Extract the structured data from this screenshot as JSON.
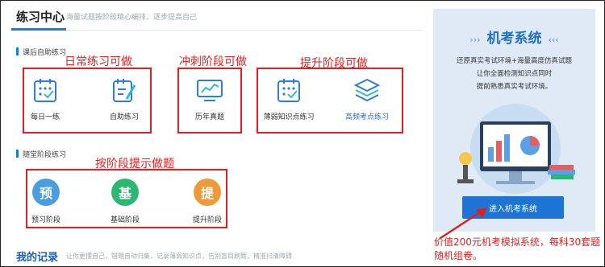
{
  "header": {
    "title": "练习中心",
    "subtitle": "海量试题按阶段精心编排，逐步提高自己"
  },
  "sections": {
    "after_class": "课后自助练习",
    "stage": "随堂阶段练习"
  },
  "annotations": {
    "daily": "日常练习可做",
    "sprint": "冲刺阶段可做",
    "improve": "提升阶段可做",
    "by_stage": "按阶段提示做题",
    "note": "价值200元机考模拟系统，每科30套题随机组卷。"
  },
  "practice_items": {
    "daily_one": "每日一练",
    "self_practice": "自助练习",
    "past_exams": "历年真题",
    "weak_points": "薄弱知识点练习",
    "high_freq": "高频考点练习"
  },
  "stage_items": {
    "preview": {
      "label": "预习阶段",
      "char": "预"
    },
    "basic": {
      "label": "基础阶段",
      "char": "基"
    },
    "advance": {
      "label": "提升阶段",
      "char": "提"
    }
  },
  "records": {
    "title": "我的记录",
    "subtitle": "让你更懂自己，错题自动归集，记录薄弱知识点，告别盲目刷题，精准扫清障碍"
  },
  "exam_panel": {
    "title": "机考系统",
    "lines": [
      "还原真实考试环境+海量高度仿真试题",
      "让你全面检测知识点同时",
      "提前熟悉真实考试环境。"
    ],
    "button": "进入机考系统"
  },
  "colors": {
    "accent": "#1e7ad9",
    "annotation": "#e02020",
    "preview": "#4a9ee0",
    "basic": "#2cb872",
    "advance": "#f0993a"
  }
}
